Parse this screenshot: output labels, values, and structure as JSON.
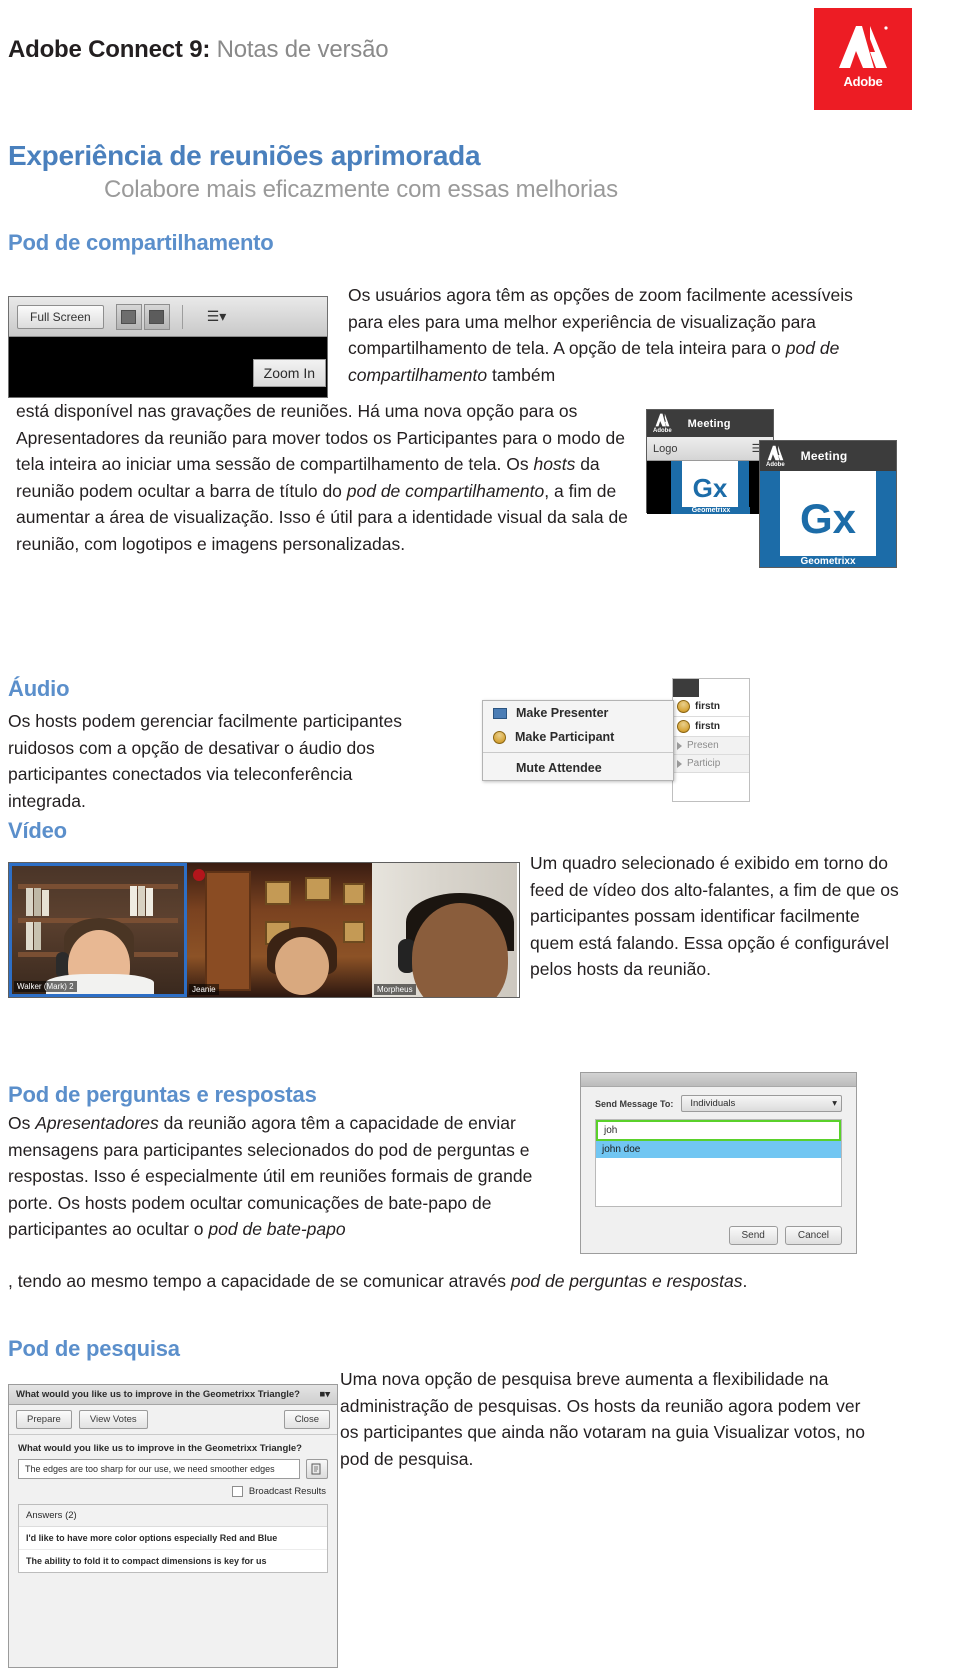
{
  "header": {
    "title_strong": "Adobe Connect 9:",
    "title_sub": " Notas de versão",
    "logo_wordmark": "Adobe",
    "logo_color": "#ed1c24"
  },
  "section": {
    "title": "Experiência de reuniões aprimorada",
    "subtitle": "Colabore mais eficazmente com essas melhorias",
    "title_color": "#4a80bd",
    "subtitle_color": "#9a9a9a"
  },
  "share_pod": {
    "heading": "Pod de compartilhamento",
    "paragraph_right": "Os usuários agora têm as opções de zoom facilmente acessíveis para eles para uma melhor experiência de visualização para compartilhamento de tela. A opção de tela inteira para o ",
    "paragraph_right_italic": "pod de compartilhamento",
    "paragraph_right_tail": " também",
    "flow_1": "está disponível nas gravações de reuniões. Há uma nova opção para os Apresentadores da reunião para mover todos os Participantes para o modo de tela inteira ao iniciar uma sessão de compartilhamento de tela. Os ",
    "flow_italic_1": "hosts",
    "flow_2": " da reunião podem ocultar a barra de título do ",
    "flow_italic_2": "pod de compartilhamento",
    "flow_3": ", a fim de aumentar a área de visualização. Isso é útil para a identidade visual da sala de reunião, com logotipos e imagens personalizadas.",
    "screenshot": {
      "full_screen_button": "Full Screen",
      "zoom_in_button": "Zoom In",
      "menu_icon": "hamburger-menu-icon"
    }
  },
  "meeting_thumbs": [
    {
      "brand": "Adobe",
      "title": "Meeting",
      "subbar_label": "Logo",
      "logo_text": "Gx",
      "logo_caption": "Geometrixx"
    },
    {
      "brand": "Adobe",
      "title": "Meeting",
      "subbar_label": "",
      "logo_text": "Gx",
      "logo_caption": "Geometrixx"
    }
  ],
  "audio": {
    "heading": "Áudio",
    "paragraph": "Os hosts podem gerenciar facilmente participantes ruidosos com a opção de desativar o áudio dos participantes conectados via teleconferência integrada.",
    "screenshot": {
      "menu_items": [
        "Make Presenter",
        "Make Participant",
        "Mute Attendee"
      ],
      "panel_rows": [
        "firstn",
        "firstn",
        "Presen",
        "Particip"
      ]
    }
  },
  "video": {
    "heading": "Vídeo",
    "paragraph": "Um quadro selecionado é exibido em torno do feed de vídeo dos alto-falantes, a fim de que os participantes possam identificar facilmente quem está falando. Essa opção é configurável pelos hosts da reunião.",
    "tiles": [
      {
        "name": "Walker (Mark) 2",
        "selected": true
      },
      {
        "name": "Jeanie",
        "selected": false
      },
      {
        "name": "Morpheus",
        "selected": false
      }
    ],
    "selection_color": "#2d6fc6"
  },
  "qa": {
    "heading": "Pod de perguntas e respostas",
    "paragraph_1": "Os ",
    "paragraph_italic_1": "Apresentadores",
    "paragraph_2": " da reunião agora têm a capacidade de enviar mensagens para participantes selecionados do pod de perguntas e respostas. Isso é especialmente útil em reuniões formais de grande porte. Os hosts podem ocultar comunicações de bate-papo de participantes ao ocultar o ",
    "paragraph_italic_2": "pod de bate-papo",
    "paragraph_3": ", tendo ao mesmo tempo a capacidade de se comunicar através ",
    "paragraph_italic_3": "pod de perguntas e respostas",
    "paragraph_4": ".",
    "dialog": {
      "send_to_label": "Send Message To:",
      "send_to_value": "Individuals",
      "search_value": "joh",
      "suggestion": "john doe",
      "send_button": "Send",
      "cancel_button": "Cancel",
      "focus_color": "#5ad12a",
      "highlight_color": "#71c6f2"
    }
  },
  "poll": {
    "heading": "Pod de pesquisa",
    "paragraph": "Uma nova opção de pesquisa breve aumenta a flexibilidade na administração de pesquisas. Os hosts da reunião agora podem ver os participantes que ainda não votaram na guia Visualizar votos, no pod de pesquisa.",
    "pod": {
      "title": "What would you like us to improve in the Geometrixx Triangle?",
      "menu_icon": "pod-options-icon",
      "buttons": [
        "Prepare",
        "View Votes",
        "Close"
      ],
      "question": "What would you like us to improve in the Geometrixx Triangle?",
      "answer_input": "The edges are too sharp for our use, we need smoother edges",
      "submit_icon": "submit-answer-icon",
      "broadcast_label": "Broadcast Results",
      "answers_header": "Answers (2)",
      "answers": [
        "I'd like to have more color options especially Red and Blue",
        "The ability to fold it to compact dimensions is key for us"
      ]
    }
  }
}
